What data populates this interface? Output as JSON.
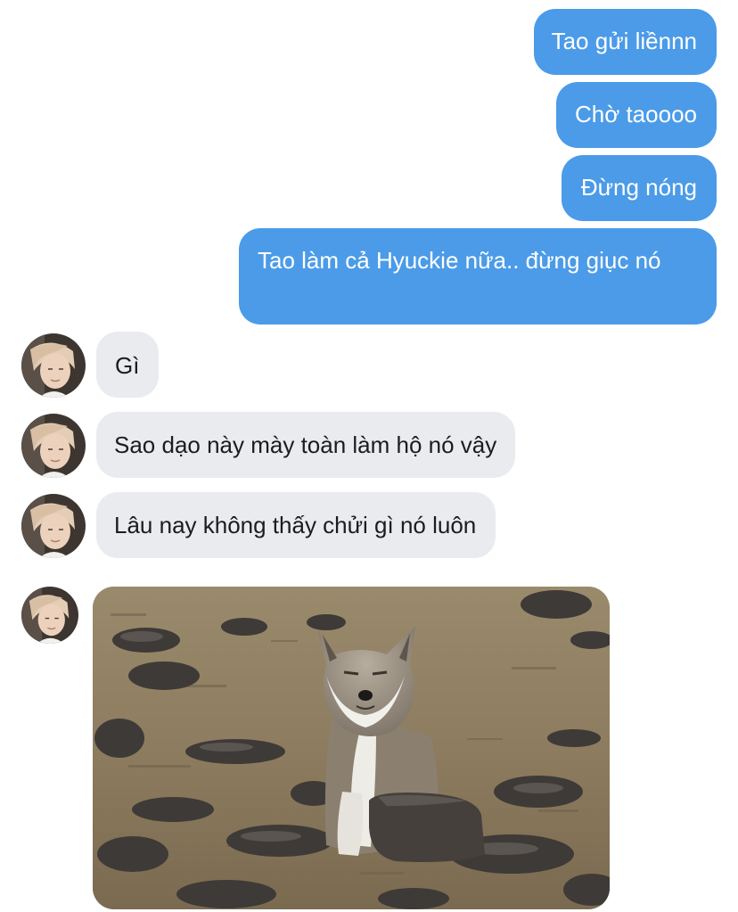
{
  "conversation": {
    "outgoing": [
      {
        "text": "Tao gửi liềnnn"
      },
      {
        "text": "Chờ taoooo"
      },
      {
        "text": "Đừng nóng"
      },
      {
        "text": "Tao làm cả Hyuckie nữa.. đừng giục nó"
      }
    ],
    "incoming": [
      {
        "text": "Gì"
      },
      {
        "text": "Sao dạo này mày toàn làm hộ nó vậy"
      },
      {
        "text": "Lâu nay không thấy chửi gì nó luôn"
      }
    ],
    "incoming_image": {
      "subject": "fox-on-rocky-ground"
    }
  },
  "colors": {
    "outgoing_bubble": "#4b9be8",
    "incoming_bubble": "#e9ebef",
    "outgoing_text": "#ffffff",
    "incoming_text": "#1c1c1e"
  }
}
